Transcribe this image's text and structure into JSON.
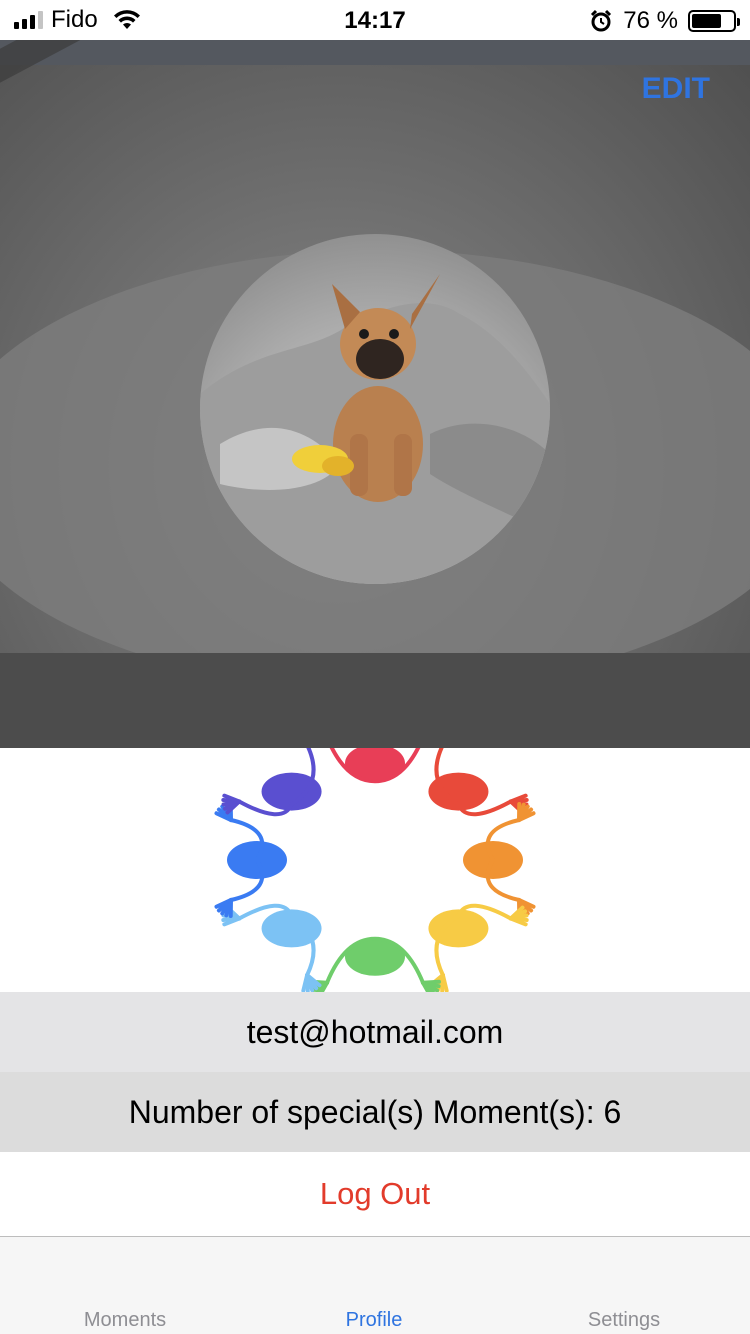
{
  "status_bar": {
    "carrier": "Fido",
    "time": "14:17",
    "battery": "76 %",
    "battery_level": 0.76
  },
  "hero": {
    "edit_label": "EDIT"
  },
  "profile": {
    "email": "test@hotmail.com",
    "moments_count_text": "Number of special(s) Moment(s): 6",
    "logout_label": "Log Out"
  },
  "tabs": [
    {
      "label": "Moments",
      "active": false
    },
    {
      "label": "Profile",
      "active": true
    },
    {
      "label": "Settings",
      "active": false
    }
  ],
  "colors": {
    "accent": "#2f74e0",
    "logout": "#e23b2b",
    "logo_colors": [
      "#e83e57",
      "#e84a3a",
      "#f09333",
      "#f7cb45",
      "#6fcd6b",
      "#7cc2f4",
      "#3a7bf2",
      "#5a4fd0"
    ]
  }
}
